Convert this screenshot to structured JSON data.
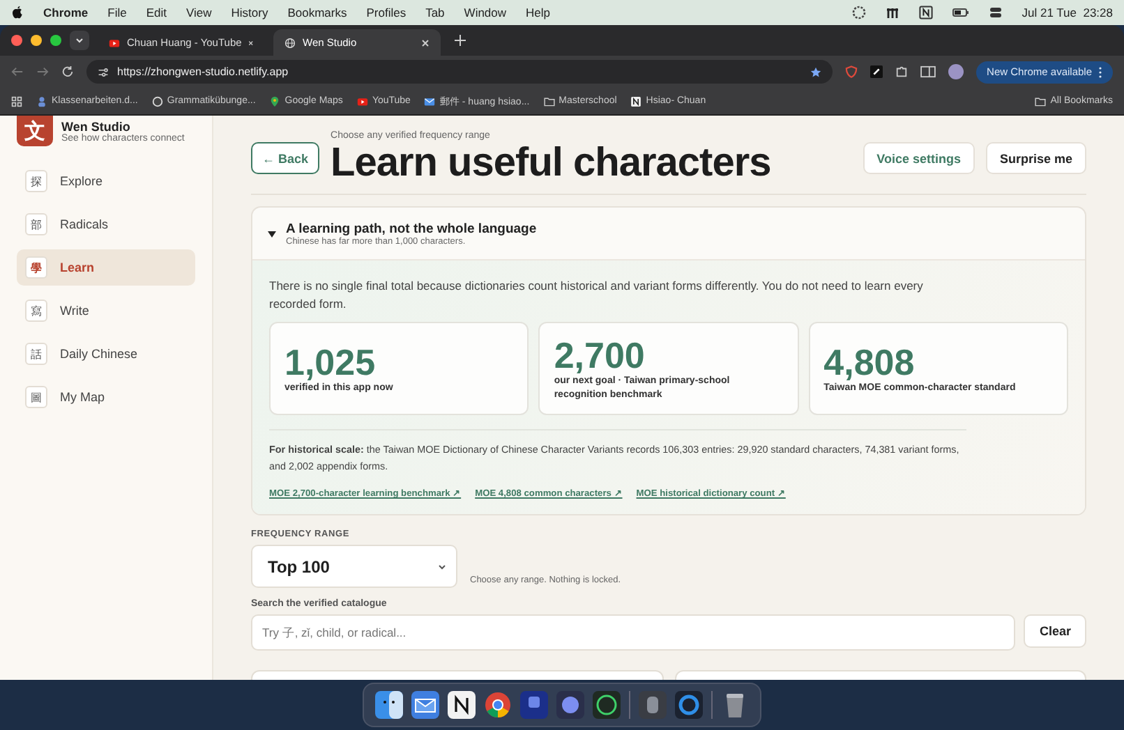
{
  "menu_bar": {
    "app": "Chrome",
    "menus": [
      "File",
      "Edit",
      "View",
      "History",
      "Bookmarks",
      "Profiles",
      "Tab",
      "Window",
      "Help"
    ],
    "clock": "Jul 21 Tue  23:28"
  },
  "browser": {
    "tabs": [
      {
        "title": "Chuan Huang - YouTube",
        "kind": "youtube",
        "selected": false
      },
      {
        "title": "Wen Studio",
        "kind": "globe",
        "selected": true
      }
    ],
    "url": "https://zhongwen-studio.netlify.app",
    "bookmarked": true,
    "update_button": "New Chrome available",
    "bookmarks": [
      {
        "label": "Klassenarbeiten.d...",
        "kind": "person"
      },
      {
        "label": "Grammatikübunge...",
        "kind": "wordpress"
      },
      {
        "label": "Google Maps",
        "kind": "maps"
      },
      {
        "label": "YouTube",
        "kind": "youtube"
      },
      {
        "label": "郵件 - huang hsiao...",
        "kind": "mail"
      },
      {
        "label": "Masterschool",
        "kind": "folder"
      },
      {
        "label": "Hsiao- Chuan",
        "kind": "notion"
      }
    ],
    "all_bookmarks": "All Bookmarks"
  },
  "sidebar": {
    "brand_mark": "文",
    "brand": "Wen Studio",
    "tagline": "See how characters connect",
    "items": [
      {
        "glyph": "探",
        "label": "Explore",
        "selected": false
      },
      {
        "glyph": "部",
        "label": "Radicals",
        "selected": false
      },
      {
        "glyph": "學",
        "label": "Learn",
        "selected": true
      },
      {
        "glyph": "寫",
        "label": "Write",
        "selected": false
      },
      {
        "glyph": "話",
        "label": "Daily Chinese",
        "selected": false
      },
      {
        "glyph": "圖",
        "label": "My Map",
        "selected": false
      }
    ]
  },
  "header": {
    "back": "← Back",
    "eyebrow": "Choose any verified frequency range",
    "title": "Learn useful characters",
    "actions": [
      {
        "label": "Voice settings",
        "kind": "accent"
      },
      {
        "label": "Surprise me",
        "kind": "plain"
      }
    ]
  },
  "info_card": {
    "title": "A learning path, not the whole language",
    "subtitle": "Chinese has far more than 1,000 characters.",
    "expanded": true,
    "intro": "There is no single final total because dictionaries count historical and variant forms differently. You do not need to learn every recorded form.",
    "stats": [
      {
        "value": "1,025",
        "label": "verified in this app now"
      },
      {
        "value": "2,700",
        "label": "our next goal · Taiwan primary-school recognition benchmark"
      },
      {
        "value": "4,808",
        "label": "Taiwan MOE common-character standard"
      }
    ],
    "note": "**For historical scale:** the Taiwan MOE Dictionary of Chinese Character Variants records 106,303 entries: 29,920 standard characters, 74,381 variant forms, and 2,002 appendix forms.",
    "links": [
      "MOE 2,700-character learning benchmark ↗",
      "MOE 4,808 common characters ↗",
      "MOE historical dictionary count ↗"
    ]
  },
  "frequency": {
    "label": "FREQUENCY RANGE",
    "value": "Top 100",
    "hint": "Choose any range. Nothing is locked."
  },
  "search": {
    "label": "Search the verified catalogue",
    "placeholder": "Try 子, zǐ, child, or radical...",
    "clear": "Clear"
  }
}
